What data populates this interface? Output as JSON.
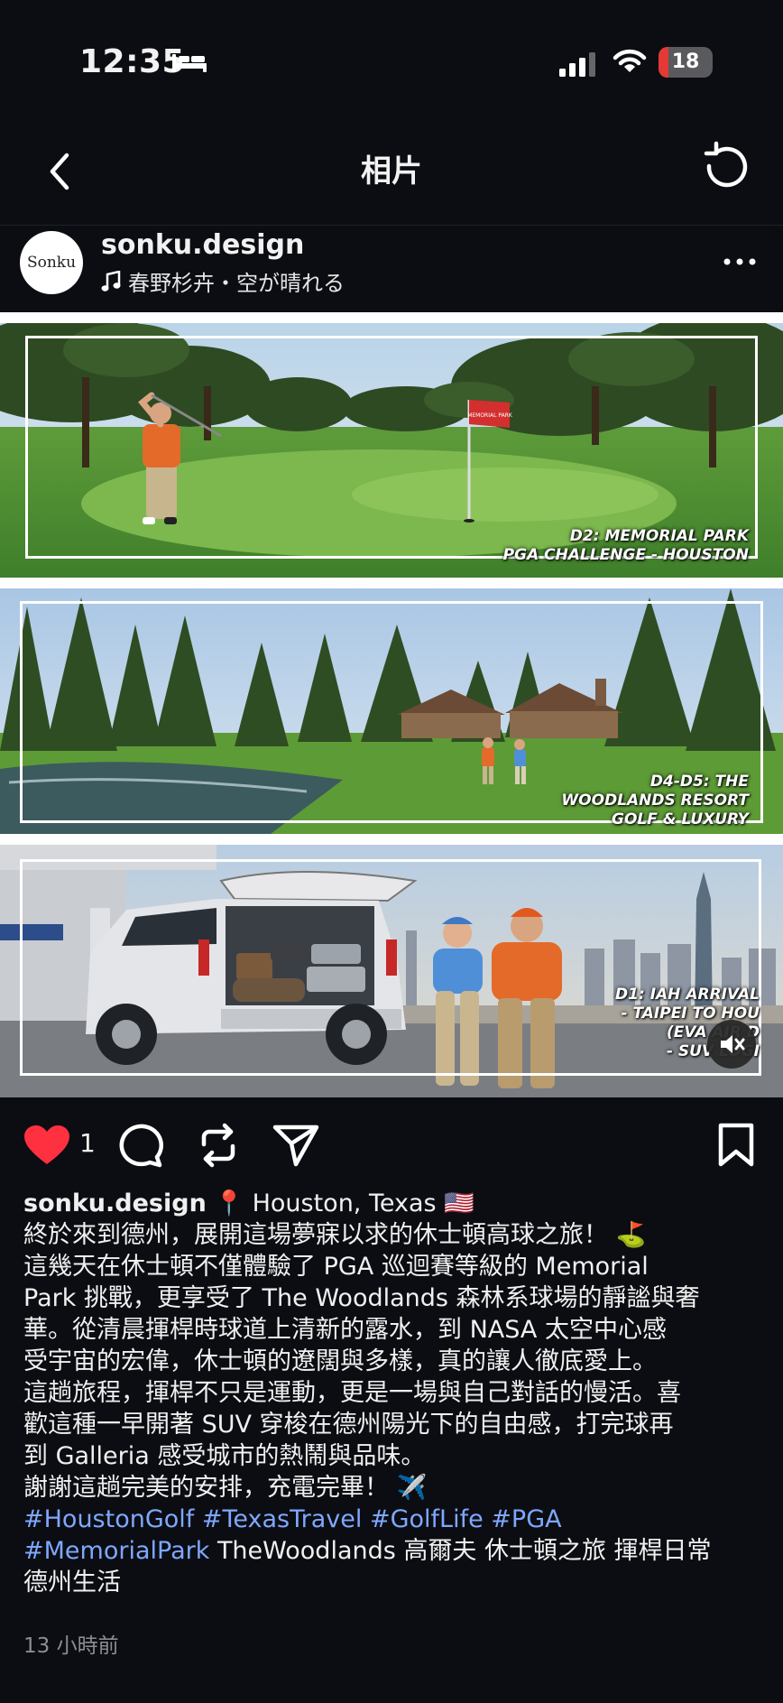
{
  "status_bar": {
    "time": "12:35",
    "battery": "18",
    "battery_level": 0.18,
    "icons": [
      "bed-icon",
      "signal-icon",
      "wifi-icon",
      "battery-icon"
    ]
  },
  "nav": {
    "title": "相片",
    "back_icon": "chevron-left-icon",
    "refresh_icon": "refresh-icon"
  },
  "post": {
    "avatar_text": "Sonku",
    "username": "sonku.design",
    "music": "春野杉卉・空が晴れる",
    "images": [
      {
        "caption_lines": [
          "D2: MEMORIAL PARK",
          "PGA CHALLENGE - HOUSTON"
        ],
        "flag_text": "MEMORIAL PARK"
      },
      {
        "caption_lines": [
          "D4-D5: THE",
          "WOODLANDS RESORT",
          "GOLF & LUXURY"
        ]
      },
      {
        "caption_lines": [
          "D1: IAH ARRIVAL",
          "- TAIPEI TO HOU",
          "(EVA AIR D",
          "- SUV LOGI"
        ]
      }
    ],
    "likes": "1",
    "caption": {
      "username": "sonku.design",
      "location": "📍 Houston, Texas 🇺🇸",
      "lines": [
        "終於來到德州，展開這場夢寐以求的休士頓高球之旅！ ⛳",
        "這幾天在休士頓不僅體驗了 PGA 巡迴賽等級的 Memorial",
        "Park 挑戰，更享受了 The Woodlands 森林系球場的靜謐與奢",
        "華。從清晨揮桿時球道上清新的露水，到 NASA 太空中心感",
        "受宇宙的宏偉，休士頓的遼闊與多樣，真的讓人徹底愛上。",
        "這趟旅程，揮桿不只是運動，更是一場與自己對話的慢活。喜",
        "歡這種一早開著 SUV 穿梭在德州陽光下的自由感，打完球再",
        "到 Galleria 感受城市的熱鬧與品味。",
        "謝謝這趟完美的安排，充電完畢！ ✈️"
      ],
      "hashtags_line1": "#HoustonGolf #TexasTravel #GolfLife #PGA",
      "hashtag_memorialpark": "#MemorialPark",
      "plain_tags": " TheWoodlands 高爾夫 休士頓之旅 揮桿日常",
      "last_line": "德州生活"
    },
    "time_ago": "13 小時前"
  }
}
